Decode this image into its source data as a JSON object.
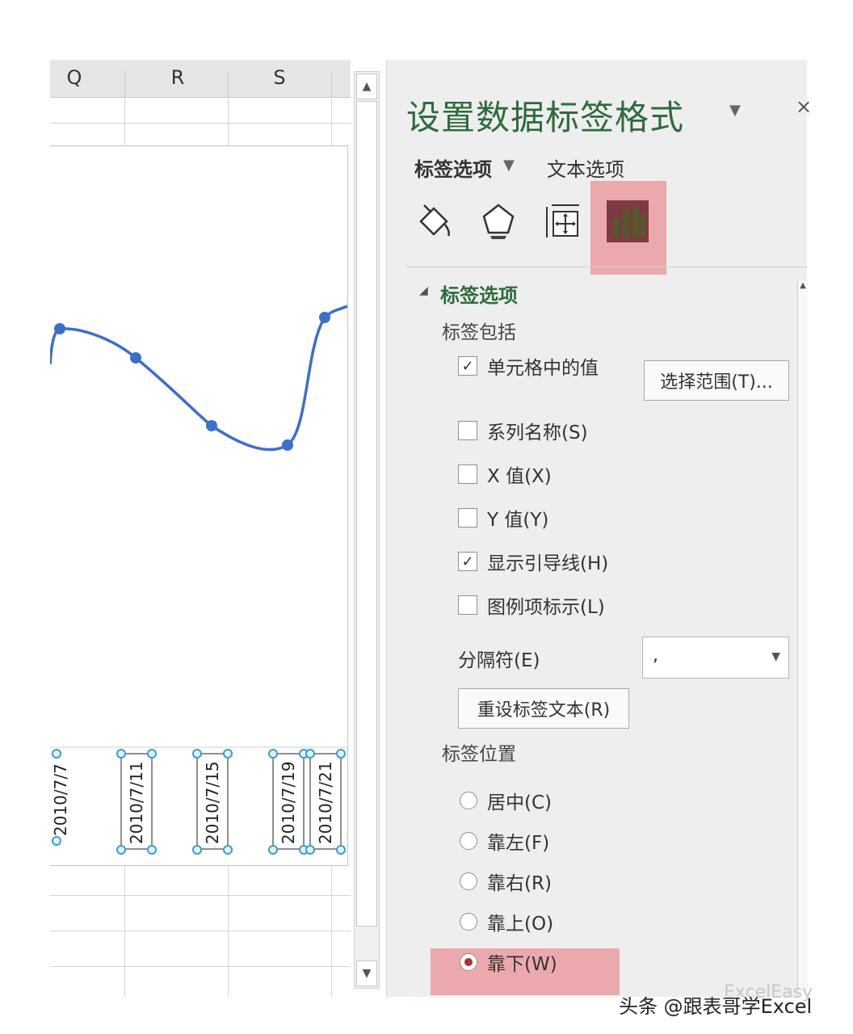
{
  "sheet": {
    "columns": [
      "Q",
      "R",
      "S"
    ],
    "chart_labels": [
      "2010/7/7",
      "2010/7/11",
      "2010/7/15",
      "2010/7/19",
      "2010/7/21"
    ]
  },
  "pane": {
    "title": "设置数据标签格式",
    "tabs": {
      "label_options": "标签选项",
      "text_options": "文本选项"
    },
    "icons": [
      "fill-line-icon",
      "effects-pentagon-icon",
      "size-properties-icon",
      "label-options-chart-icon"
    ],
    "section_title": "标签选项",
    "label_contains": {
      "title": "标签包括",
      "items": [
        {
          "label": "单元格中的值",
          "checked": true
        },
        {
          "label": "系列名称(S)",
          "checked": false
        },
        {
          "label": "X 值(X)",
          "checked": false
        },
        {
          "label": "Y 值(Y)",
          "checked": false
        },
        {
          "label": "显示引导线(H)",
          "checked": true
        },
        {
          "label": "图例项标示(L)",
          "checked": false
        }
      ],
      "select_range_button": "选择范围(T)..."
    },
    "separator": {
      "label": "分隔符(E)",
      "value": ","
    },
    "reset_button": "重设标签文本(R)",
    "label_position": {
      "title": "标签位置",
      "options": [
        {
          "label": "居中(C)",
          "selected": false
        },
        {
          "label": "靠左(F)",
          "selected": false
        },
        {
          "label": "靠右(R)",
          "selected": false
        },
        {
          "label": "靠上(O)",
          "selected": false
        },
        {
          "label": "靠下(W)",
          "selected": true
        }
      ]
    },
    "colors": {
      "title_green": "#2e6b3c",
      "highlight": "#eba9ae",
      "radio_dot": "#a8323a"
    }
  },
  "watermark": {
    "text": "头条 @跟表哥学Excel",
    "brand": "ExcelEasy"
  }
}
